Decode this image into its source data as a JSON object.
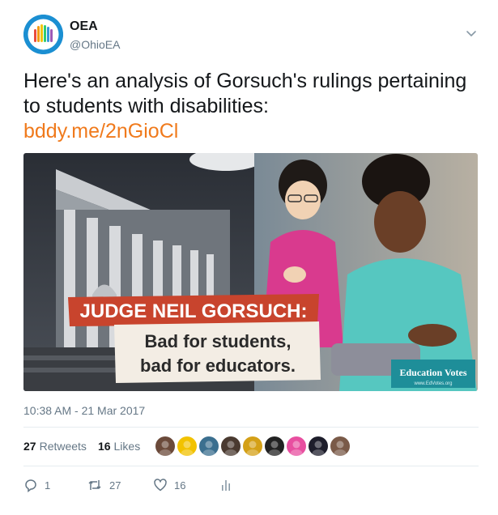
{
  "author": {
    "name": "OEA",
    "handle": "@OhioEA"
  },
  "tweet": {
    "text": "Here's an analysis of Gorsuch's rulings pertaining to students with disabilities:",
    "link": "bddy.me/2nGioCl"
  },
  "media": {
    "headline": "JUDGE NEIL GORSUCH:",
    "line1": "Bad for students,",
    "line2": "bad for educators.",
    "logo": "Education Votes",
    "logo_url": "www.EdVotes.org"
  },
  "timestamp": "10:38 AM - 21 Mar 2017",
  "stats": {
    "retweets_count": "27",
    "retweets_label": "Retweets",
    "likes_count": "16",
    "likes_label": "Likes"
  },
  "likers": [
    {
      "color": "#6b4a3a"
    },
    {
      "color": "#f2c200"
    },
    {
      "color": "#3b6f8f"
    },
    {
      "color": "#4a3a30"
    },
    {
      "color": "#d4a017"
    },
    {
      "color": "#222222"
    },
    {
      "color": "#e84fa0"
    },
    {
      "color": "#1d1d2b"
    },
    {
      "color": "#7a5a48"
    }
  ],
  "actions": {
    "replies": "1",
    "retweets": "27",
    "likes": "16"
  },
  "icons": {
    "caret": "chevron-down-icon",
    "reply": "reply-icon",
    "retweet": "retweet-icon",
    "like": "heart-icon",
    "analytics": "analytics-icon"
  },
  "colors": {
    "link": "#f07a1c",
    "secondary": "#657786",
    "banner_red": "#c8442d"
  }
}
